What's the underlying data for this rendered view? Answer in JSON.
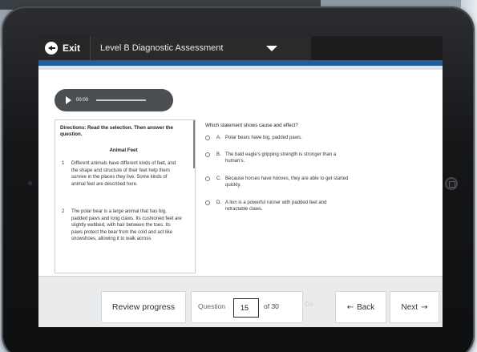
{
  "app": {
    "exit_label": "Exit",
    "assessment_title": "Level B Diagnostic Assessment"
  },
  "background": {
    "strip_text": [
      "Review progress",
      "Question",
      "15",
      "of 30",
      "Back",
      "Next"
    ]
  },
  "audio": {
    "time": "00:00"
  },
  "passage": {
    "directions": "Directions: Read the selection. Then answer the question.",
    "title": "Animal Feet",
    "paragraphs": [
      {
        "number": "1",
        "text": "Different animals have different kinds of feet, and the shape and structure of their feet help them survive in the places they live. Some kinds of animal feet are described here."
      },
      {
        "number": "2",
        "text": "The polar bear is a large animal that has big, padded paws and long claws. Its cushioned feet are slightly webbed, with hair between the toes. Its paws protect the bear from the cold and act like snowshoes, allowing it to walk across"
      }
    ]
  },
  "question": {
    "prompt": "Which statement shows cause and effect?",
    "choices": [
      {
        "letter": "A.",
        "text": "Polar bears have big, padded paws."
      },
      {
        "letter": "B.",
        "text": "The bald eagle's gripping strength is stronger than a human's."
      },
      {
        "letter": "C.",
        "text": "Because horses have hooves, they are able to get started quickly."
      },
      {
        "letter": "D.",
        "text": "A lion is a powerful runner with padded feet and retractable claws."
      }
    ]
  },
  "nav": {
    "review_label": "Review progress",
    "question_label": "Question",
    "question_number": "15",
    "of_total": "of 30",
    "go_label": "Go",
    "back_label": "Back",
    "next_label": "Next",
    "back_arrow": "←",
    "next_arrow": "→"
  },
  "colors": {
    "topbar": "#1d1d1f",
    "accent_blue": "#1d5fa5",
    "nav_bg": "#e9ebed"
  }
}
